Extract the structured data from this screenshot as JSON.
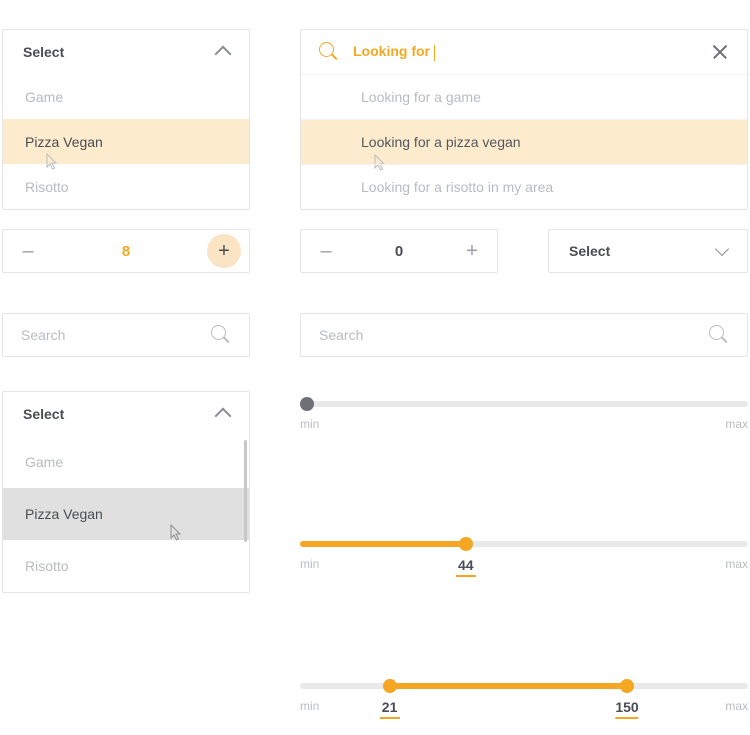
{
  "colors": {
    "accent": "#f5a623",
    "accent_light": "#fdebce"
  },
  "select1": {
    "label": "Select",
    "options": [
      "Game",
      "Pizza Vegan",
      "Risotto"
    ],
    "highlighted_index": 1
  },
  "select2": {
    "label": "Select",
    "options": [
      "Game",
      "Pizza Vegan",
      "Risotto"
    ],
    "highlighted_index": 1
  },
  "select_closed": {
    "label": "Select"
  },
  "stepper_left": {
    "value": "8",
    "minus": "–",
    "plus": "+"
  },
  "stepper_mid": {
    "value": "0",
    "minus": "–",
    "plus": "+"
  },
  "search1": {
    "placeholder": "Search"
  },
  "search2": {
    "placeholder": "Search"
  },
  "autocomplete": {
    "query": "Looking for",
    "suggestions": [
      "Looking for a game",
      "Looking for a pizza vegan",
      "Looking for a risotto in my area"
    ],
    "highlighted_index": 1
  },
  "slider1": {
    "min_label": "min",
    "max_label": "max",
    "value_percent": 0
  },
  "slider2": {
    "min_label": "min",
    "max_label": "max",
    "value_label": "44",
    "value_percent": 37
  },
  "slider3": {
    "min_label": "min",
    "max_label": "max",
    "low_label": "21",
    "high_label": "150",
    "low_percent": 20,
    "high_percent": 73
  }
}
